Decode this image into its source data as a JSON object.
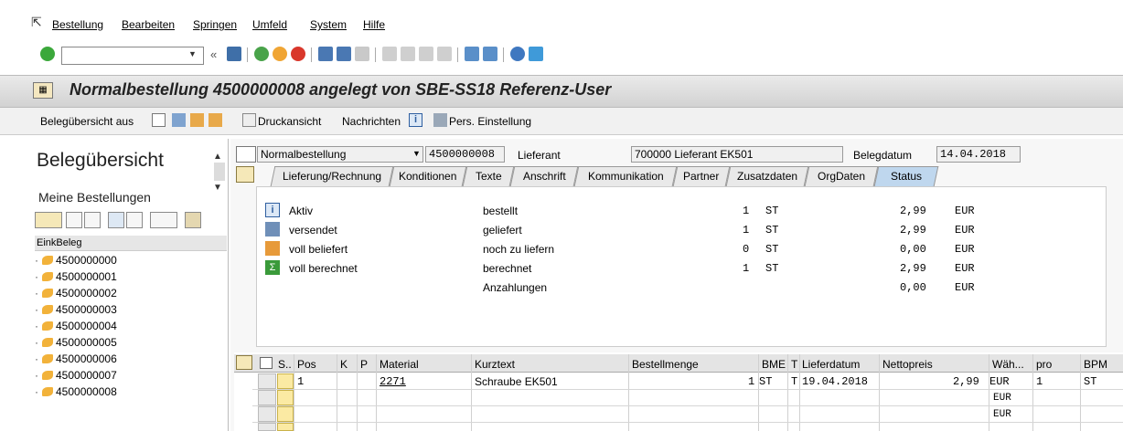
{
  "menu": {
    "items": [
      "Bestellung",
      "Bearbeiten",
      "Springen",
      "Umfeld",
      "System",
      "Hilfe"
    ]
  },
  "title": "Normalbestellung 4500000008 angelegt von SBE-SS18 Referenz-User",
  "app_toolbar": {
    "overview": "Belegübersicht aus",
    "print_preview": "Druckansicht",
    "messages": "Nachrichten",
    "personal": "Pers. Einstellung"
  },
  "left_panel": {
    "title": "Belegübersicht",
    "subtitle": "Meine Bestellungen",
    "column": "EinkBeleg",
    "items": [
      "4500000000",
      "4500000001",
      "4500000002",
      "4500000003",
      "4500000004",
      "4500000005",
      "4500000006",
      "4500000007",
      "4500000008"
    ]
  },
  "header": {
    "doc_type": "Normalbestellung",
    "doc_number": "4500000008",
    "vendor_label": "Lieferant",
    "vendor_value": "700000 Lieferant EK501",
    "date_label": "Belegdatum",
    "date_value": "14.04.2018"
  },
  "tabs": [
    "Lieferung/Rechnung",
    "Konditionen",
    "Texte",
    "Anschrift",
    "Kommunikation",
    "Partner",
    "Zusatzdaten",
    "OrgDaten",
    "Status"
  ],
  "active_tab": "Status",
  "status": {
    "left": [
      "Aktiv",
      "versendet",
      "voll beliefert",
      "voll berechnet"
    ],
    "rows": [
      {
        "label": "bestellt",
        "qty": "1",
        "unit": "ST",
        "amount": "2,99",
        "cur": "EUR"
      },
      {
        "label": "geliefert",
        "qty": "1",
        "unit": "ST",
        "amount": "2,99",
        "cur": "EUR"
      },
      {
        "label": "noch zu liefern",
        "qty": "0",
        "unit": "ST",
        "amount": "0,00",
        "cur": "EUR"
      },
      {
        "label": "berechnet",
        "qty": "1",
        "unit": "ST",
        "amount": "2,99",
        "cur": "EUR"
      },
      {
        "label": "Anzahlungen",
        "qty": "",
        "unit": "",
        "amount": "0,00",
        "cur": "EUR"
      }
    ]
  },
  "grid": {
    "columns": [
      "S..",
      "Pos",
      "K",
      "P",
      "Material",
      "Kurztext",
      "Bestellmenge",
      "BME",
      "T",
      "Lieferdatum",
      "Nettopreis",
      "Wäh...",
      "pro",
      "BPM"
    ],
    "row1": {
      "pos": "1",
      "material": "2271",
      "text": "Schraube EK501",
      "qty": "1",
      "bme": "ST",
      "t": "T",
      "date": "19.04.2018",
      "price": "2,99",
      "cur": "EUR",
      "pro": "1",
      "bpm": "ST"
    },
    "empty_cur": "EUR"
  },
  "colors": {
    "accent": "#bfd7ee",
    "title_bg": "#d8d8d8",
    "row_marker": "#fbeaa3"
  }
}
